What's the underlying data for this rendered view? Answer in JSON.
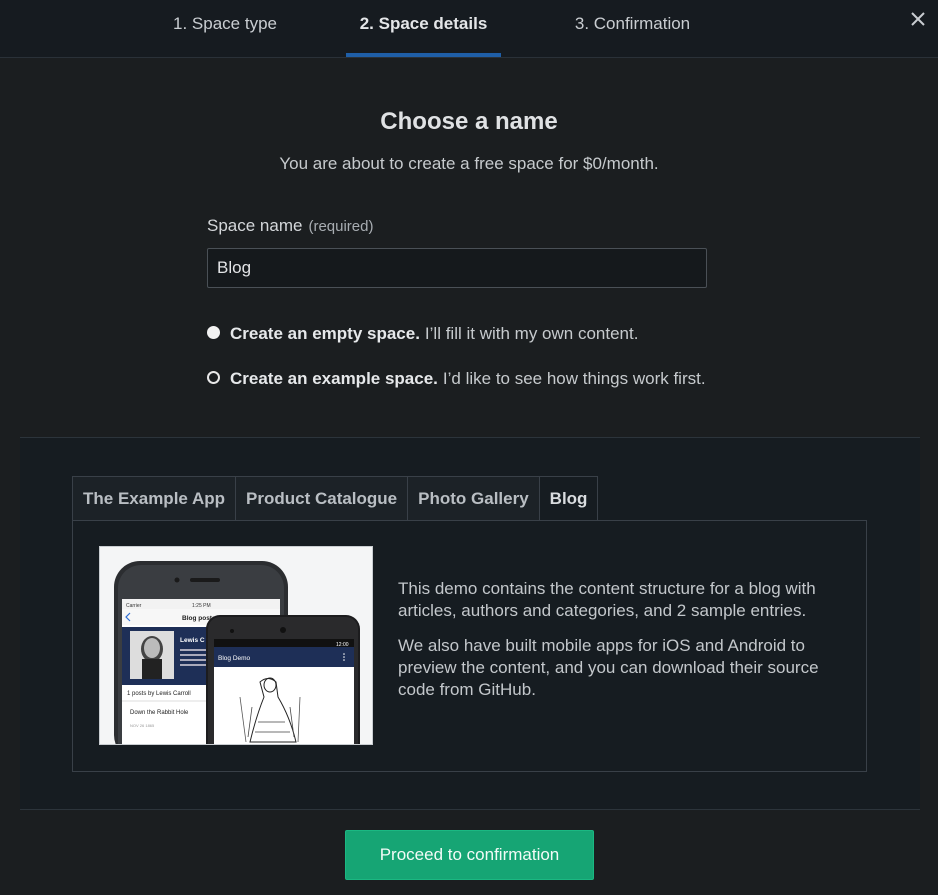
{
  "stepper": {
    "steps": [
      "1. Space type",
      "2. Space details",
      "3. Confirmation"
    ],
    "active_index": 1
  },
  "title": "Choose a name",
  "subtitle": "You are about to create a free space for $0/month.",
  "space_name": {
    "label": "Space name",
    "required": "(required)",
    "value": "Blog"
  },
  "options": [
    {
      "bold": "Create an empty space.",
      "text": "I’ll fill it with my own content.",
      "checked": false
    },
    {
      "bold": "Create an example space.",
      "text": "I’d like to see how things work first.",
      "checked": true
    }
  ],
  "example_tabs": [
    "The Example App",
    "Product Catalogue",
    "Photo Gallery",
    "Blog"
  ],
  "active_tab_index": 3,
  "preview": {
    "carrier": "Carrier",
    "time_ios": "1:25 PM",
    "header_ios": "Blog posts",
    "author_name": "Lewis C",
    "author_bio": "Charles Lut... January 18... better know... Carroll, wa...",
    "posts_by": "1 posts by Lewis Carroll",
    "post_title": "Down the Rabbit Hole",
    "post_date": "NOV 26 1865",
    "time_android": "12:00",
    "android_title": "Blog Demo"
  },
  "description": [
    "This demo contains the content structure for a blog with articles, authors and categories, and 2 sample entries.",
    "We also have built mobile apps for iOS and Android to preview the content, and you can download their source code from GitHub."
  ],
  "proceed_label": "Proceed to confirmation",
  "icons": {
    "close": "close-icon"
  },
  "colors": {
    "accent": "#16a574",
    "tab_underline": "#1f5fa8",
    "background": "#1b1e20"
  }
}
